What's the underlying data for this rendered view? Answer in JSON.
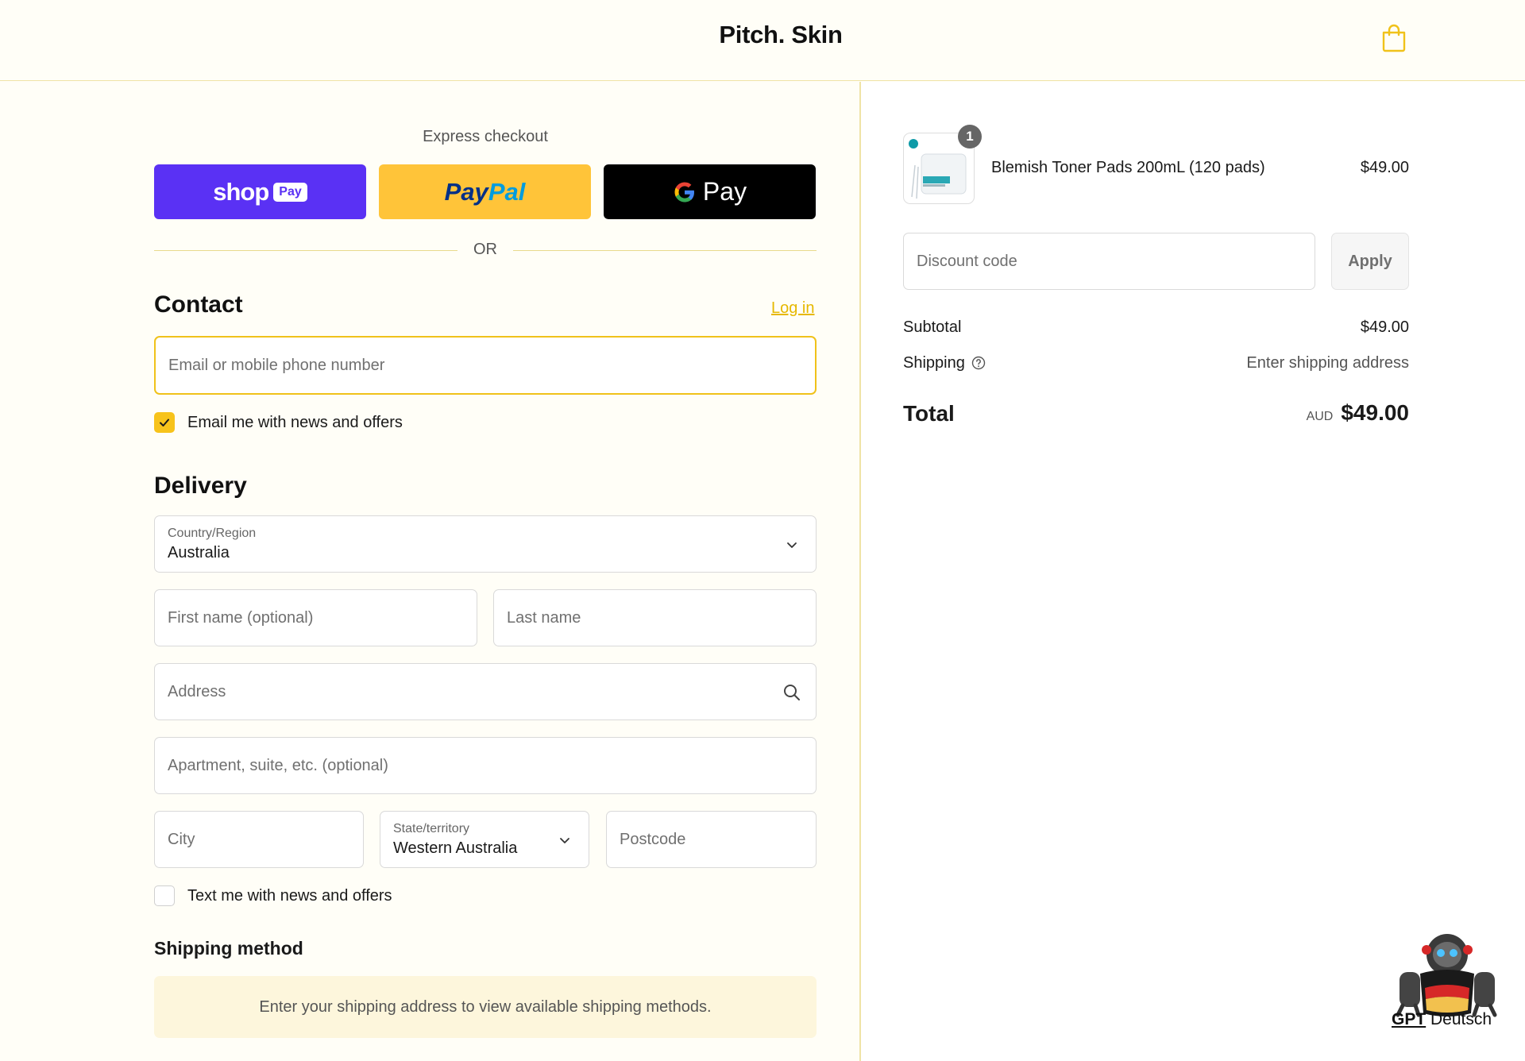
{
  "header": {
    "brand": "Pitch. Skin",
    "cart_icon": "shopping-bag-icon"
  },
  "express": {
    "title": "Express checkout",
    "shop_pay_word": "shop",
    "shop_pay_badge": "Pay",
    "paypal_pay": "Pay",
    "paypal_pal": "Pal",
    "gpay_word": "Pay",
    "or_text": "OR"
  },
  "contact": {
    "title": "Contact",
    "login_link": "Log in",
    "email_placeholder": "Email or mobile phone number",
    "email_value": "",
    "news_label": "Email me with news and offers",
    "news_checked": true
  },
  "delivery": {
    "title": "Delivery",
    "country_label": "Country/Region",
    "country_value": "Australia",
    "first_name_placeholder": "First name (optional)",
    "last_name_placeholder": "Last name",
    "address_placeholder": "Address",
    "apartment_placeholder": "Apartment, suite, etc. (optional)",
    "city_placeholder": "City",
    "state_label": "State/territory",
    "state_value": "Western Australia",
    "postcode_placeholder": "Postcode",
    "text_label": "Text me with news and offers",
    "text_checked": false
  },
  "shipping_method": {
    "title": "Shipping method",
    "notice": "Enter your shipping address to view available shipping methods."
  },
  "summary": {
    "item": {
      "name": "Blemish Toner Pads 200mL (120 pads)",
      "price": "$49.00",
      "quantity": "1"
    },
    "discount_placeholder": "Discount code",
    "apply_label": "Apply",
    "subtotal_label": "Subtotal",
    "subtotal_value": "$49.00",
    "shipping_label": "Shipping",
    "shipping_value": "Enter shipping address",
    "total_label": "Total",
    "currency": "AUD",
    "total_value": "$49.00"
  },
  "watermark": {
    "bold": "GPT",
    "text": "Deutsch"
  },
  "colors": {
    "accent": "#f0c21a",
    "shop_pay": "#5a31f4",
    "paypal": "#ffc439",
    "gpay": "#000000"
  }
}
